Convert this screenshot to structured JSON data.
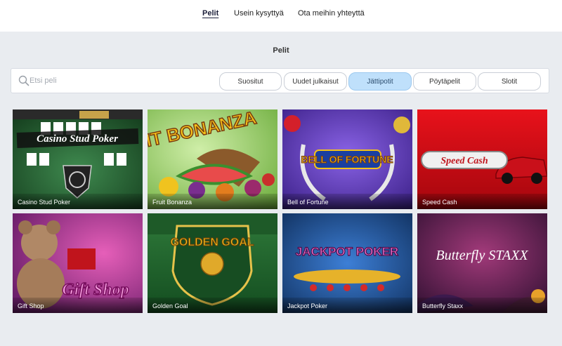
{
  "nav": {
    "items": [
      {
        "label": "Pelit",
        "active": true
      },
      {
        "label": "Usein kysyttyä",
        "active": false
      },
      {
        "label": "Ota meihin yhteyttä",
        "active": false
      }
    ]
  },
  "section": {
    "title": "Pelit"
  },
  "search": {
    "placeholder": "Etsi peli"
  },
  "filters": [
    {
      "label": "Suositut",
      "active": false
    },
    {
      "label": "Uudet julkaisut",
      "active": false
    },
    {
      "label": "Jättipotit",
      "active": true
    },
    {
      "label": "Pöytäpelit",
      "active": false
    },
    {
      "label": "Slotit",
      "active": false
    }
  ],
  "games": [
    {
      "title": "Casino Stud Poker",
      "logo": "Casino Stud Poker",
      "icon": "card-table-icon"
    },
    {
      "title": "Fruit Bonanza",
      "logo": "FRUIT BONANZA",
      "icon": "fruit-icon"
    },
    {
      "title": "Bell of Fortune",
      "logo": "BELL OF FORTUNE",
      "icon": "bell-icon"
    },
    {
      "title": "Speed Cash",
      "logo": "Speed Cash",
      "icon": "race-car-icon"
    },
    {
      "title": "Gift Shop",
      "logo": "Gift Shop",
      "icon": "teddy-bear-icon"
    },
    {
      "title": "Golden Goal",
      "logo": "GOLDEN GOAL",
      "icon": "soccer-ball-icon"
    },
    {
      "title": "Jackpot Poker",
      "logo": "JACKPOT POKER",
      "icon": "coins-icon"
    },
    {
      "title": "Butterfly Staxx",
      "logo": "Butterfly STAXX",
      "icon": "butterfly-icon"
    }
  ],
  "colors": {
    "page_bg": "#e9ecf0",
    "active_filter_bg": "#bfe0fb",
    "nav_active": "#1c1f3a"
  }
}
